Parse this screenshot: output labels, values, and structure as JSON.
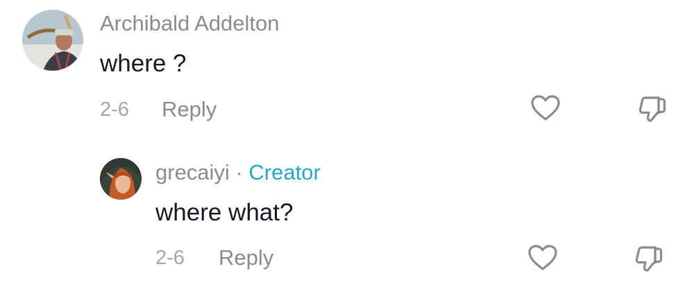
{
  "comments": [
    {
      "username": "Archibald Addelton",
      "text": "where ?",
      "date": "2-6",
      "reply_label": "Reply",
      "like_icon": "heart-outline-icon",
      "dislike_icon": "thumbs-down-outline-icon"
    }
  ],
  "replies": [
    {
      "username": "grecaiyi",
      "separator": "·",
      "badge": "Creator",
      "text": "where what?",
      "date": "2-6",
      "reply_label": "Reply",
      "like_icon": "heart-outline-icon",
      "dislike_icon": "thumbs-down-outline-icon"
    }
  ],
  "colors": {
    "username": "#8a8b91",
    "text": "#161823",
    "date": "#a4a5ab",
    "creator_badge": "#2aa5c7",
    "icon": "#8a8b91"
  }
}
